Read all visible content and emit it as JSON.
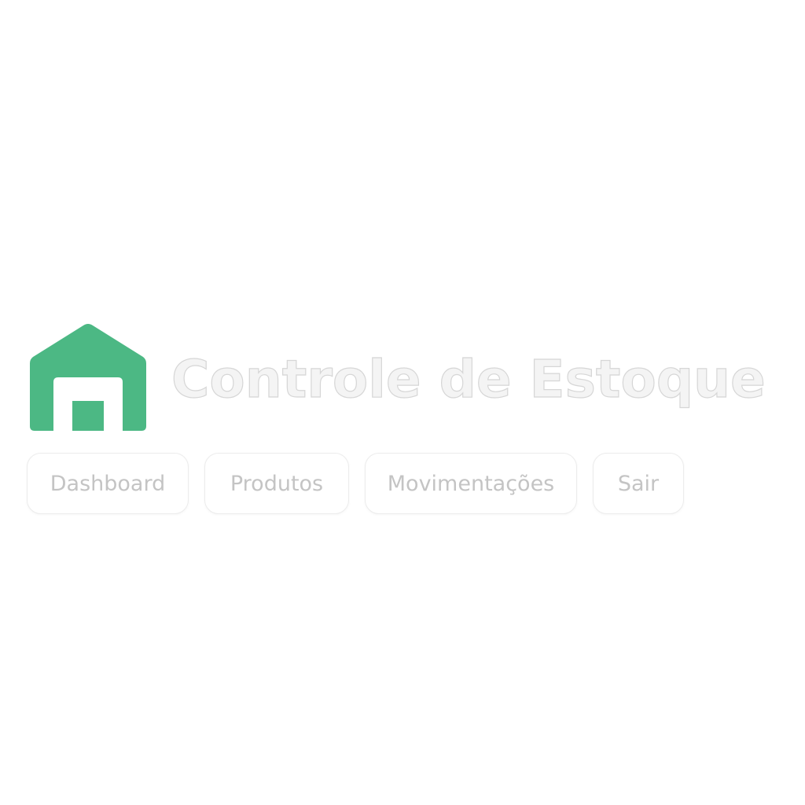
{
  "app": {
    "title": "Controle de Estoque",
    "logo_icon": "warehouse-icon",
    "accent_color": "#4cb884"
  },
  "nav": {
    "items": [
      {
        "label": "Dashboard"
      },
      {
        "label": "Produtos"
      },
      {
        "label": "Movimentações"
      },
      {
        "label": "Sair"
      }
    ]
  }
}
